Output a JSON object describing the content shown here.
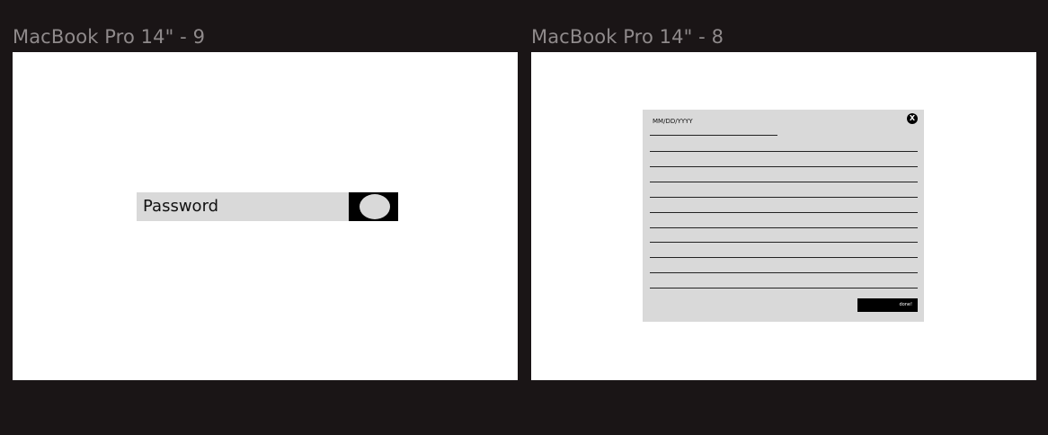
{
  "canvas": {
    "frames": [
      {
        "label": "MacBook Pro 14\" - 9"
      },
      {
        "label": "MacBook Pro 14\" - 8"
      }
    ]
  },
  "frame9": {
    "password_label": "Password"
  },
  "frame8": {
    "date_placeholder": "MM/DD/YYYY",
    "close_label": "X",
    "done_label": "done!"
  },
  "colors": {
    "canvas_bg": "#1a1516",
    "frame_bg": "#ffffff",
    "panel_gray": "#d9d9d9",
    "black": "#000000"
  }
}
